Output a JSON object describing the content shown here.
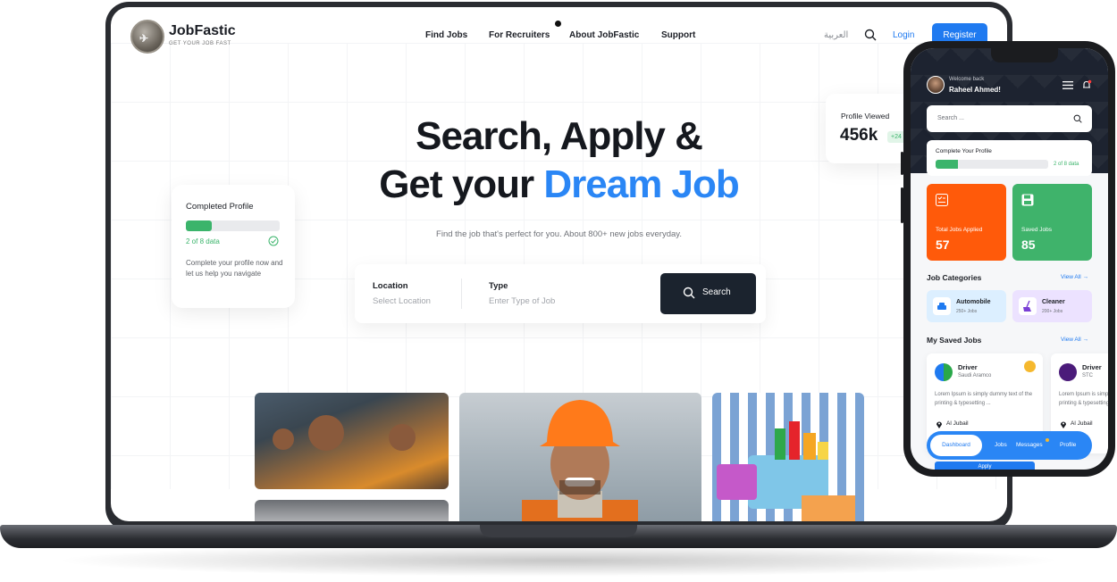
{
  "nav": {
    "brand": "JobFastic",
    "tagline": "GET YOUR JOB FAST",
    "links": [
      "Find Jobs",
      "For Recruiters",
      "About JobFastic",
      "Support"
    ],
    "language": "العربية",
    "login": "Login",
    "register": "Register"
  },
  "hero": {
    "line1": "Search, Apply &",
    "line2_prefix": "Get your ",
    "line2_highlight": "Dream Job",
    "subtitle": "Find the job that's perfect for you. About 800+ new jobs everyday."
  },
  "search": {
    "location_label": "Location",
    "location_placeholder": "Select Location",
    "type_label": "Type",
    "type_placeholder": "Enter Type of Job",
    "button": "Search"
  },
  "completed_profile": {
    "title": "Completed Profile",
    "count": "2 of 8 data",
    "progress": 0.28,
    "description": "Complete your profile now and let us help you navigate"
  },
  "profile_viewed": {
    "title": "Profile Viewed",
    "value": "456k",
    "change": "+24"
  },
  "mobile": {
    "welcome": "Welcome back",
    "name": "Raheel Ahmed!",
    "search_placeholder": "Search ...",
    "profile": {
      "title": "Complete Your Profile",
      "count": "2 of 8 data",
      "progress": 0.2
    },
    "stats": [
      {
        "label": "Total Jobs Applied",
        "value": "57",
        "color": "#ff5a0a"
      },
      {
        "label": "Saved Jobs",
        "value": "85",
        "color": "#3fb36b"
      }
    ],
    "categories_title": "Job Categories",
    "view_all": "View All →",
    "categories": [
      {
        "name": "Automobile",
        "count": "250+ Jobs"
      },
      {
        "name": "Cleaner",
        "count": "200+ Jobs"
      }
    ],
    "saved_title": "My Saved Jobs",
    "saved_jobs": [
      {
        "title": "Driver",
        "company": "Saudi Aramco",
        "description": "Lorem Ipsum is simply dummy text of the printing & typesetting ...",
        "location": "Al Jubail"
      },
      {
        "title": "Driver",
        "company": "STC",
        "description": "Lorem Ipsum is simply dummy text of the printing & typesetting ...",
        "location": "Al Jubail"
      }
    ],
    "tabs": [
      "Dashboard",
      "Jobs",
      "Messages",
      "Profile"
    ],
    "apply": "Apply"
  }
}
